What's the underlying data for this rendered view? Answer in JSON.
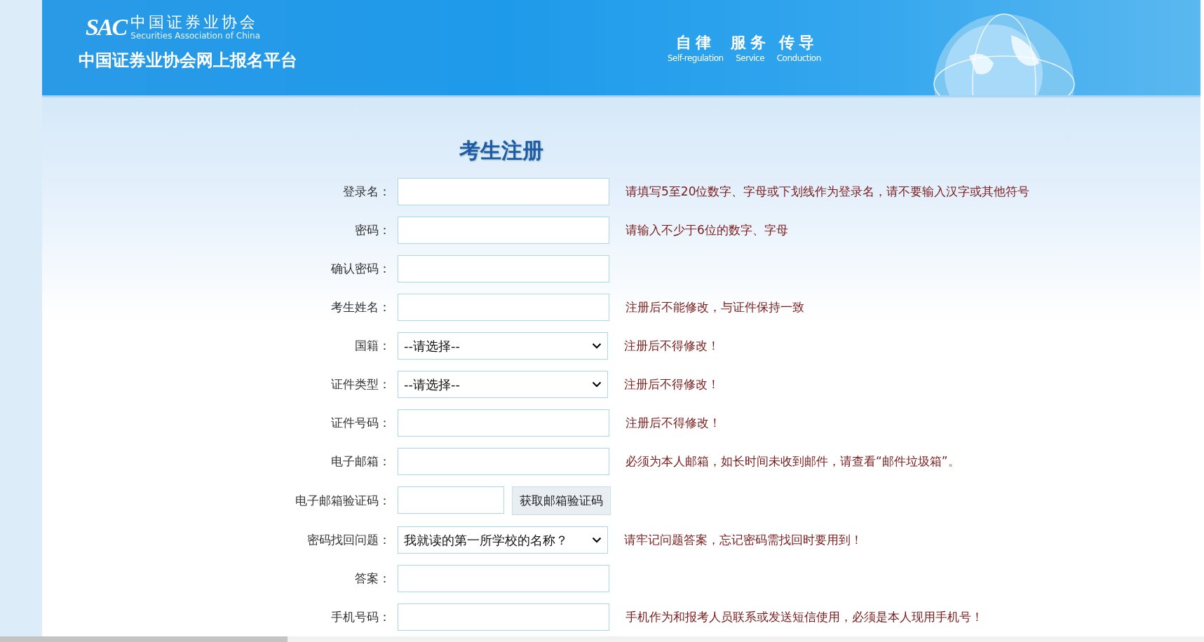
{
  "header": {
    "logo_mark": "SAC",
    "org_name": "中国证券业协会",
    "org_name_en": "Securities Association of China",
    "platform_title": "中国证券业协会网上报名平台",
    "slogans": [
      {
        "zh": "自律",
        "en": "Self-regulation"
      },
      {
        "zh": "服务",
        "en": "Service"
      },
      {
        "zh": "传导",
        "en": "Conduction"
      }
    ]
  },
  "form": {
    "title": "考生注册",
    "fields": [
      {
        "label": "登录名：",
        "kind": "text",
        "hint": "请填写5至20位数字、字母或下划线作为登录名，请不要输入汉字或其他符号"
      },
      {
        "label": "密码：",
        "kind": "text",
        "hint": "请输入不少于6位的数字、字母"
      },
      {
        "label": "确认密码：",
        "kind": "text"
      },
      {
        "label": "考生姓名：",
        "kind": "text",
        "hint": "注册后不能修改，与证件保持一致"
      },
      {
        "label": "国籍：",
        "kind": "select",
        "value": "--请选择--",
        "hint": "注册后不得修改！"
      },
      {
        "label": "证件类型：",
        "kind": "select",
        "value": "--请选择--",
        "hint": "注册后不得修改！"
      },
      {
        "label": "证件号码：",
        "kind": "text",
        "hint": "注册后不得修改！"
      },
      {
        "label": "电子邮箱：",
        "kind": "text",
        "hint": "必须为本人邮箱，如长时间未收到邮件，请查看“邮件垃圾箱”。"
      },
      {
        "label": "电子邮箱验证码：",
        "kind": "code",
        "button": "获取邮箱验证码"
      },
      {
        "label": "密码找回问题：",
        "kind": "select",
        "value": "我就读的第一所学校的名称？",
        "hint": "请牢记问题答案，忘记密码需找回时要用到！"
      },
      {
        "label": "答案：",
        "kind": "text"
      },
      {
        "label": "手机号码：",
        "kind": "text",
        "hint": "手机作为和报考人员联系或发送短信使用，必须是本人现用手机号！"
      }
    ]
  }
}
